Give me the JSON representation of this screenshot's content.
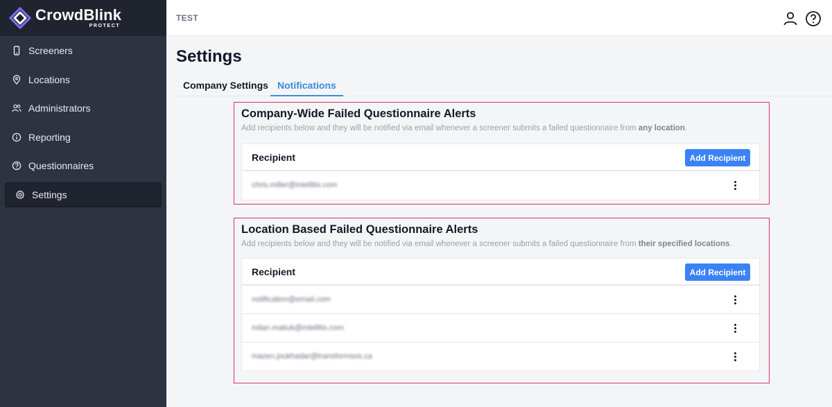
{
  "brand": {
    "name": "CrowdBlink",
    "sub": "PROTECT",
    "accent": "#7c6cf2"
  },
  "sidebar": {
    "items": [
      {
        "label": "Screeners",
        "icon": "phone-icon"
      },
      {
        "label": "Locations",
        "icon": "map-pin-icon"
      },
      {
        "label": "Administrators",
        "icon": "users-icon"
      },
      {
        "label": "Reporting",
        "icon": "info-icon"
      },
      {
        "label": "Questionnaires",
        "icon": "question-icon"
      },
      {
        "label": "Settings",
        "icon": "gear-icon",
        "active": true
      }
    ]
  },
  "topbar": {
    "org": "TEST",
    "icons": [
      "user-icon",
      "help-icon"
    ]
  },
  "page": {
    "title": "Settings"
  },
  "tabs": [
    {
      "label": "Company Settings",
      "active": false
    },
    {
      "label": "Notifications",
      "active": true
    }
  ],
  "sections": [
    {
      "title": "Company-Wide Failed Questionnaire Alerts",
      "desc_prefix": "Add recipients below and they will be notified via email whenever a screener submits a failed questionnaire from ",
      "desc_bold": "any location",
      "desc_suffix": ".",
      "column": "Recipient",
      "add_label": "Add Recipient",
      "recipients": [
        "chris.miller@intellitix.com"
      ]
    },
    {
      "title": "Location Based Failed Questionnaire Alerts",
      "desc_prefix": "Add recipients below and they will be notified via email whenever a screener submits a failed questionnaire from ",
      "desc_bold": "their specified locations",
      "desc_suffix": ".",
      "column": "Recipient",
      "add_label": "Add Recipient",
      "recipients": [
        "notification@email.com",
        "milan.matiuk@intellitix.com",
        "mazen.joukhadar@transformsos.ca"
      ]
    }
  ],
  "colors": {
    "sidebar": "#2d3340",
    "highlight_border": "#d6336c",
    "button": "#3b82f6",
    "tab_active": "#3b8bd8"
  }
}
